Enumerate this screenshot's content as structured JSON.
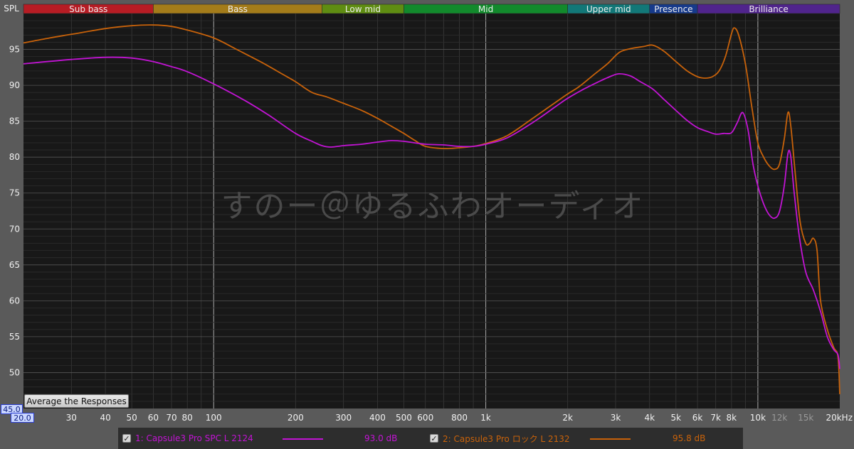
{
  "spl_label": "SPL",
  "y_min_box": "45.0",
  "x_min_box": "20.0",
  "watermark": "すのー＠ゆるふわオーディオ",
  "average_button": "Average the Responses",
  "bands": [
    {
      "name": "Sub bass",
      "from": 20,
      "to": 60,
      "color": "#b71c24"
    },
    {
      "name": "Bass",
      "from": 60,
      "to": 250,
      "color": "#a47c1a"
    },
    {
      "name": "Low mid",
      "from": 250,
      "to": 500,
      "color": "#5f8d12"
    },
    {
      "name": "Mid",
      "from": 500,
      "to": 2000,
      "color": "#128a2c"
    },
    {
      "name": "Upper mid",
      "from": 2000,
      "to": 4000,
      "color": "#127878"
    },
    {
      "name": "Presence",
      "from": 4000,
      "to": 6000,
      "color": "#163a8c"
    },
    {
      "name": "Brilliance",
      "from": 6000,
      "to": 20000,
      "color": "#50248c"
    }
  ],
  "colors": {
    "series1": "#c214d4",
    "series2": "#c8620a"
  },
  "chart_data": {
    "type": "line",
    "ylabel": "SPL",
    "xlabel": "",
    "xscale": "log",
    "xlim": [
      20,
      20000
    ],
    "ylim": [
      45,
      100
    ],
    "y_ticks": [
      50,
      55,
      60,
      65,
      70,
      75,
      80,
      85,
      90,
      95
    ],
    "x_ticks": [
      {
        "v": 30,
        "label": "30"
      },
      {
        "v": 40,
        "label": "40"
      },
      {
        "v": 50,
        "label": "50"
      },
      {
        "v": 60,
        "label": "60"
      },
      {
        "v": 70,
        "label": "70"
      },
      {
        "v": 80,
        "label": "80"
      },
      {
        "v": 100,
        "label": "100"
      },
      {
        "v": 200,
        "label": "200"
      },
      {
        "v": 300,
        "label": "300"
      },
      {
        "v": 400,
        "label": "400"
      },
      {
        "v": 500,
        "label": "500"
      },
      {
        "v": 600,
        "label": "600"
      },
      {
        "v": 800,
        "label": "800"
      },
      {
        "v": 1000,
        "label": "1k"
      },
      {
        "v": 2000,
        "label": "2k"
      },
      {
        "v": 3000,
        "label": "3k"
      },
      {
        "v": 4000,
        "label": "4k"
      },
      {
        "v": 5000,
        "label": "5k"
      },
      {
        "v": 6000,
        "label": "6k"
      },
      {
        "v": 7000,
        "label": "7k"
      },
      {
        "v": 8000,
        "label": "8k"
      },
      {
        "v": 10000,
        "label": "10k"
      },
      {
        "v": 12000,
        "label": "12k",
        "dim": true
      },
      {
        "v": 15000,
        "label": "15k",
        "dim": true
      },
      {
        "v": 20000,
        "label": "20kHz"
      }
    ],
    "series": [
      {
        "name": "1: Capsule3 Pro SPC L 2124",
        "level": "93.0 dB",
        "points": [
          [
            20,
            93
          ],
          [
            30,
            93.6
          ],
          [
            40,
            93.9
          ],
          [
            50,
            93.8
          ],
          [
            60,
            93.3
          ],
          [
            70,
            92.6
          ],
          [
            80,
            91.9
          ],
          [
            100,
            90.2
          ],
          [
            130,
            87.9
          ],
          [
            160,
            85.8
          ],
          [
            200,
            83.3
          ],
          [
            230,
            82.2
          ],
          [
            250,
            81.6
          ],
          [
            270,
            81.4
          ],
          [
            300,
            81.6
          ],
          [
            350,
            81.8
          ],
          [
            400,
            82.1
          ],
          [
            450,
            82.3
          ],
          [
            500,
            82.2
          ],
          [
            600,
            81.8
          ],
          [
            700,
            81.7
          ],
          [
            800,
            81.5
          ],
          [
            900,
            81.5
          ],
          [
            1000,
            81.8
          ],
          [
            1200,
            82.7
          ],
          [
            1500,
            84.9
          ],
          [
            1800,
            87
          ],
          [
            2000,
            88.2
          ],
          [
            2300,
            89.5
          ],
          [
            2600,
            90.5
          ],
          [
            2900,
            91.3
          ],
          [
            3100,
            91.6
          ],
          [
            3400,
            91.3
          ],
          [
            3700,
            90.5
          ],
          [
            4100,
            89.5
          ],
          [
            4500,
            88.1
          ],
          [
            5000,
            86.5
          ],
          [
            5500,
            85.1
          ],
          [
            6000,
            84.1
          ],
          [
            6500,
            83.6
          ],
          [
            7000,
            83.2
          ],
          [
            7500,
            83.3
          ],
          [
            8000,
            83.4
          ],
          [
            8400,
            84.8
          ],
          [
            8800,
            86.2
          ],
          [
            9200,
            83.8
          ],
          [
            9600,
            79
          ],
          [
            10000,
            76
          ],
          [
            10500,
            73.5
          ],
          [
            11000,
            72
          ],
          [
            11500,
            71.5
          ],
          [
            12000,
            72.4
          ],
          [
            12500,
            76
          ],
          [
            12900,
            80.5
          ],
          [
            13200,
            80.2
          ],
          [
            13600,
            75
          ],
          [
            14200,
            69
          ],
          [
            15000,
            64
          ],
          [
            16000,
            61.5
          ],
          [
            17000,
            58.5
          ],
          [
            18000,
            55
          ],
          [
            19000,
            53.2
          ],
          [
            19700,
            52.5
          ],
          [
            20000,
            50.5
          ]
        ]
      },
      {
        "name": "2: Capsule3 Pro ロック L 2132",
        "level": "95.8 dB",
        "points": [
          [
            20,
            95.9
          ],
          [
            25,
            96.6
          ],
          [
            30,
            97.1
          ],
          [
            40,
            97.9
          ],
          [
            50,
            98.3
          ],
          [
            60,
            98.4
          ],
          [
            70,
            98.2
          ],
          [
            80,
            97.7
          ],
          [
            100,
            96.6
          ],
          [
            120,
            95.1
          ],
          [
            150,
            93.2
          ],
          [
            180,
            91.5
          ],
          [
            200,
            90.5
          ],
          [
            230,
            89
          ],
          [
            260,
            88.4
          ],
          [
            300,
            87.5
          ],
          [
            350,
            86.5
          ],
          [
            400,
            85.4
          ],
          [
            450,
            84.3
          ],
          [
            500,
            83.3
          ],
          [
            550,
            82.3
          ],
          [
            600,
            81.5
          ],
          [
            700,
            81.2
          ],
          [
            800,
            81.3
          ],
          [
            900,
            81.5
          ],
          [
            1000,
            81.9
          ],
          [
            1200,
            83
          ],
          [
            1500,
            85.5
          ],
          [
            1800,
            87.6
          ],
          [
            2000,
            88.8
          ],
          [
            2200,
            89.8
          ],
          [
            2500,
            91.5
          ],
          [
            2800,
            93
          ],
          [
            3100,
            94.6
          ],
          [
            3400,
            95.1
          ],
          [
            3800,
            95.4
          ],
          [
            4100,
            95.6
          ],
          [
            4500,
            94.8
          ],
          [
            5000,
            93.3
          ],
          [
            5500,
            92
          ],
          [
            6000,
            91.2
          ],
          [
            6400,
            91
          ],
          [
            6800,
            91.2
          ],
          [
            7200,
            92
          ],
          [
            7600,
            94
          ],
          [
            8000,
            97.2
          ],
          [
            8200,
            98
          ],
          [
            8500,
            97
          ],
          [
            9000,
            93
          ],
          [
            9500,
            87
          ],
          [
            10000,
            82
          ],
          [
            10500,
            80
          ],
          [
            11000,
            78.8
          ],
          [
            11500,
            78.3
          ],
          [
            12000,
            79
          ],
          [
            12500,
            82.5
          ],
          [
            12900,
            86.2
          ],
          [
            13200,
            84.5
          ],
          [
            13700,
            78
          ],
          [
            14300,
            71
          ],
          [
            15000,
            68
          ],
          [
            15500,
            68
          ],
          [
            16000,
            68.7
          ],
          [
            16500,
            67
          ],
          [
            17000,
            60
          ],
          [
            18000,
            56
          ],
          [
            19000,
            53.5
          ],
          [
            19700,
            52.2
          ],
          [
            20000,
            47
          ]
        ]
      }
    ]
  }
}
